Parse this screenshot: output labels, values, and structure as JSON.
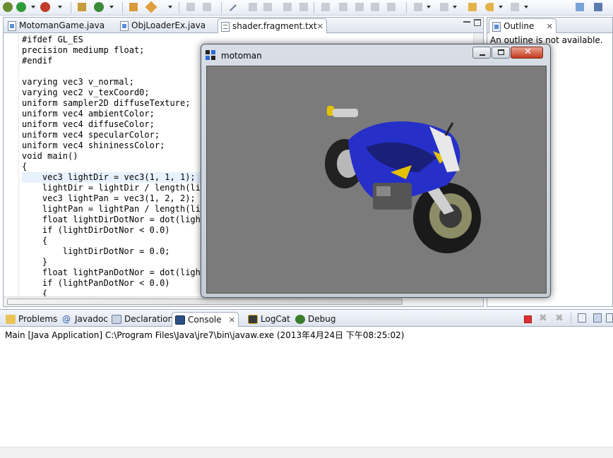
{
  "editor": {
    "tabs": [
      {
        "label": "MotomanGame.java",
        "active": false
      },
      {
        "label": "ObjLoaderEx.java",
        "active": false
      },
      {
        "label": "shader.fragment.txt",
        "active": true
      }
    ],
    "code_lines": [
      "#ifdef GL_ES",
      "precision mediump float;",
      "#endif",
      "",
      "varying vec3 v_normal;",
      "varying vec2 v_texCoord0;",
      "uniform sampler2D diffuseTexture;",
      "uniform vec4 ambientColor;",
      "uniform vec4 diffuseColor;",
      "uniform vec4 specularColor;",
      "uniform vec4 shininessColor;",
      "void main()",
      "{",
      "    vec3 lightDir = vec3(1, 1, 1);",
      "    lightDir = lightDir / length(lightDir);",
      "    vec3 lightPan = vec3(1, 2, 2);",
      "    lightPan = lightPan / length(lightPan);",
      "    float lightDirDotNor = dot(lightDir, v_normal);",
      "    if (lightDirDotNor < 0.0)",
      "    {",
      "        lightDirDotNor = 0.0;",
      "    }",
      "    float lightPanDotNor = dot(lightPan, v_normal);",
      "    if (lightPanDotNor < 0.0)",
      "    {"
    ]
  },
  "outline": {
    "tab_label": "Outline",
    "message": "An outline is not available."
  },
  "console": {
    "tabs": [
      {
        "label": "Problems",
        "icon": "problems-icon"
      },
      {
        "label": "Javadoc",
        "icon": "javadoc-icon"
      },
      {
        "label": "Declaration",
        "icon": "declaration-icon"
      },
      {
        "label": "Console",
        "icon": "console-icon",
        "active": true
      },
      {
        "label": "LogCat",
        "icon": "logcat-icon"
      },
      {
        "label": "Debug",
        "icon": "debug-icon"
      }
    ],
    "info": "Main [Java Application] C:\\Program Files\\Java\\jre7\\bin\\javaw.exe (2013年4月24日 下午08:25:02)"
  },
  "app_window": {
    "title": "motoman"
  },
  "colors": {
    "viewport_bg": "#7b7b7b",
    "bike_blue": "#2630c8",
    "terminate_red": "#e03030"
  }
}
